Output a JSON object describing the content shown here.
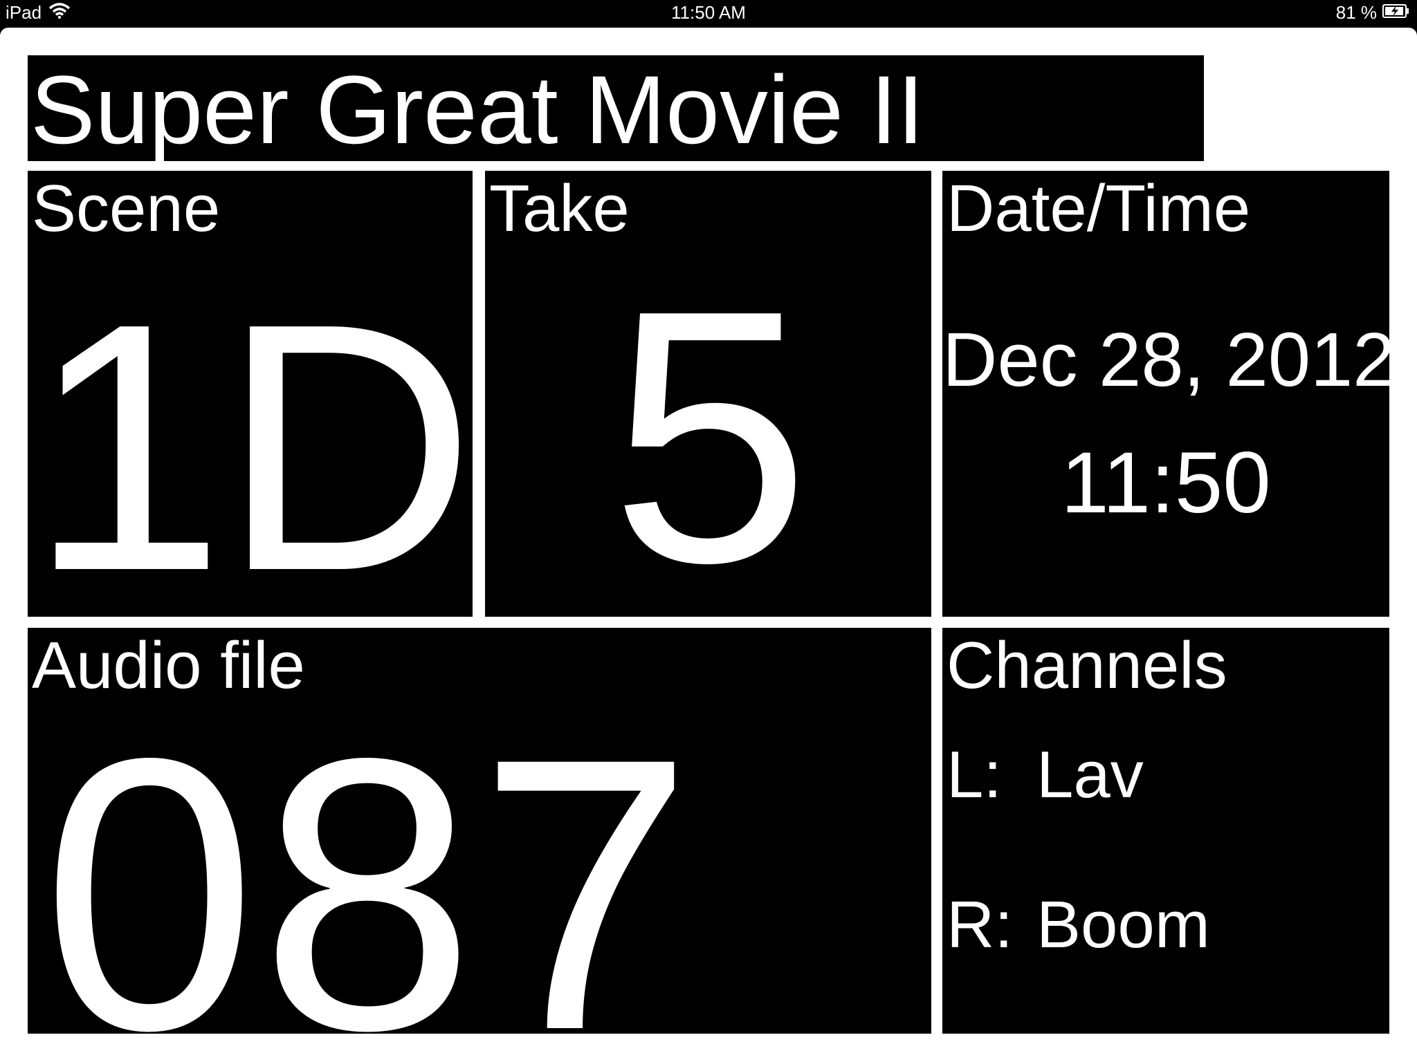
{
  "status_bar": {
    "device": "iPad",
    "time": "11:50 AM",
    "battery": "81 %",
    "wifi_icon": "wifi-icon",
    "battery_icon": "battery-charging-icon"
  },
  "slate": {
    "title": "Super Great Movie II",
    "scene": {
      "label": "Scene",
      "value": "1D"
    },
    "take": {
      "label": "Take",
      "value": "5"
    },
    "datetime": {
      "label": "Date/Time",
      "date": "Dec 28, 2012",
      "time": "11:50"
    },
    "audio_file": {
      "label": "Audio file",
      "value": "087"
    },
    "channels": {
      "label": "Channels",
      "left": {
        "key": "L:",
        "value": "Lav"
      },
      "right": {
        "key": "R:",
        "value": "Boom"
      }
    }
  },
  "colors": {
    "background": "#000000",
    "frame": "#ffffff",
    "text": "#ffffff"
  }
}
